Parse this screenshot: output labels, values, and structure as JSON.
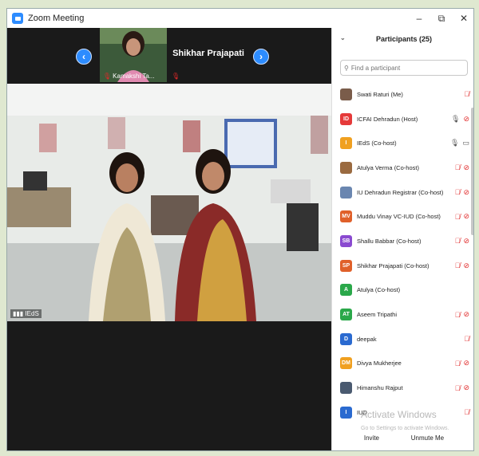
{
  "window": {
    "title": "Zoom Meeting",
    "controls": [
      "–",
      "⧉",
      "✕"
    ]
  },
  "thumbnails": {
    "tile_name": "Kamakshi Ta...",
    "speaker_name": "Shikhar Prajapati",
    "prev_arrow": "‹",
    "next_arrow": "›"
  },
  "main_video": {
    "label": "IEdS"
  },
  "participants": {
    "header": "Participants (25)",
    "collapse_icon": "⌄",
    "search_placeholder": "Find a participant",
    "items": [
      {
        "name": "Swati Raturi (Me)",
        "initials": "",
        "color": "#7a5c4a",
        "mic": "off",
        "video": ""
      },
      {
        "name": "ICFAI Dehradun (Host)",
        "initials": "ID",
        "color": "#e53a3a",
        "mic": "on",
        "video": "off"
      },
      {
        "name": "IEdS (Co-host)",
        "initials": "I",
        "color": "#f0a020",
        "mic": "on-gray",
        "video": "on-gray"
      },
      {
        "name": "Atulya Verma (Co-host)",
        "initials": "",
        "color": "#9a6a40",
        "mic": "off",
        "video": "off"
      },
      {
        "name": "IU Dehradun Registrar (Co-host)",
        "initials": "",
        "color": "#6a86b0",
        "mic": "off",
        "video": "off"
      },
      {
        "name": "Muddu Vinay VC-IUD (Co-host)",
        "initials": "MV",
        "color": "#e0602a",
        "mic": "off",
        "video": "off"
      },
      {
        "name": "Shallu Babbar (Co-host)",
        "initials": "SB",
        "color": "#8a4ad0",
        "mic": "off",
        "video": "off"
      },
      {
        "name": "Shikhar Prajapati (Co-host)",
        "initials": "SP",
        "color": "#e0602a",
        "mic": "off",
        "video": "off"
      },
      {
        "name": "Atulya (Co-host)",
        "initials": "A",
        "color": "#2aa84a",
        "mic": "",
        "video": ""
      },
      {
        "name": "Aseem Tripathi",
        "initials": "AT",
        "color": "#2aa84a",
        "mic": "off",
        "video": "off"
      },
      {
        "name": "deepak",
        "initials": "D",
        "color": "#2a6ad0",
        "mic": "off",
        "video": ""
      },
      {
        "name": "Divya Mukherjee",
        "initials": "DM",
        "color": "#f0a020",
        "mic": "off",
        "video": "off"
      },
      {
        "name": "Himanshu Rajput",
        "initials": "",
        "color": "#4a5a70",
        "mic": "off",
        "video": "off"
      },
      {
        "name": "IUD",
        "initials": "I",
        "color": "#2a6ad0",
        "mic": "off",
        "video": ""
      }
    ],
    "footer": {
      "invite": "Invite",
      "unmute": "Unmute Me"
    }
  },
  "watermark": {
    "title": "Activate Windows",
    "subtitle": "Go to Settings to activate Windows."
  }
}
